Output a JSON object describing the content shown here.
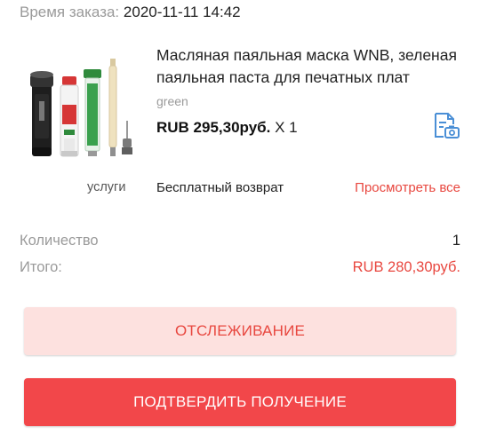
{
  "order": {
    "time_label": "Время заказа:",
    "time_value": "2020-11-11 14:42"
  },
  "product": {
    "title": "Масляная паяльная маска WNB, зеленая паяльная паста для печатных плат",
    "variant": "green",
    "price": "RUB 295,30руб.",
    "quantity_text": "X 1",
    "image_icon": "product-thumbnail",
    "snapshot_icon": "document-camera-icon"
  },
  "services": {
    "label": "услуги",
    "value": "Бесплатный возврат",
    "link": "Просмотреть все"
  },
  "summary": {
    "quantity_label": "Количество",
    "quantity_value": "1",
    "total_label": "Итого:",
    "total_value": "RUB 280,30руб."
  },
  "actions": {
    "track_label": "ОТСЛЕЖИВАНИЕ",
    "confirm_label": "ПОДТВЕРДИТЬ ПОЛУЧЕНИЕ"
  },
  "colors": {
    "accent": "#e8473f",
    "confirm_bg": "#f2474a",
    "track_bg": "#fde1df",
    "icon_blue": "#4a8fd6",
    "muted": "#9a9a9a"
  }
}
